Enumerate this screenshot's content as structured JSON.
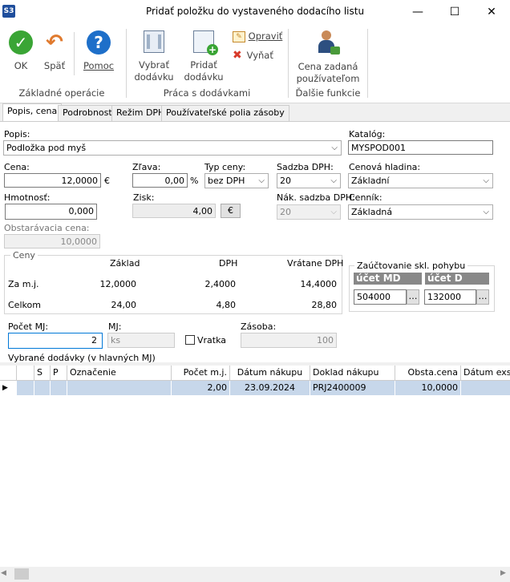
{
  "window": {
    "icon_text": "S3",
    "title": "Pridať položku do vystaveného dodacího listu",
    "minimize": "—",
    "maximize": "☐",
    "close": "✕"
  },
  "ribbon": {
    "ok": "OK",
    "back": "Späť",
    "help": "Pomoc",
    "group_basic": "Základné operácie",
    "select_line1": "Vybrať",
    "select_line2": "dodávku",
    "add_line1": "Pridať",
    "add_line2": "dodávku",
    "edit": "Opraviť",
    "remove": "Vyňať",
    "group_deliveries": "Práca s dodávkami",
    "user_price_line1": "Cena zadaná",
    "user_price_line2": "používateľom",
    "group_other": "Ďalšie funkcie"
  },
  "tabs": [
    "Popis, cena",
    "Podrobnosti",
    "Režim DPH",
    "Používateľské polia zásoby"
  ],
  "form": {
    "popis_label": "Popis:",
    "popis_value": "Podložka pod myš",
    "katalog_label": "Katalóg:",
    "katalog_value": "MYSPOD001",
    "cena_label": "Cena:",
    "cena_value": "12,0000",
    "currency": "€",
    "zlava_label": "Zľava:",
    "zlava_value": "0,00",
    "percent": "%",
    "typ_ceny_label": "Typ ceny:",
    "typ_ceny_value": "bez DPH",
    "sadzba_label": "Sadzba DPH:",
    "sadzba_value": "20",
    "cenova_label": "Cenová hladina:",
    "cenova_value": "Základní",
    "hmotnost_label": "Hmotnosť:",
    "hmotnost_value": "0,000",
    "zisk_label": "Zisk:",
    "zisk_value": "4,00",
    "zisk_btn": "€",
    "nak_sadzba_label": "Nák. sadzba DPH:",
    "nak_sadzba_value": "20",
    "cennik_label": "Cenník:",
    "cennik_value": "Základná",
    "obstaravacia_label": "Obstarávacia cena:",
    "obstaravacia_value": "10,0000"
  },
  "ceny": {
    "title": "Ceny",
    "col_zaklad": "Základ",
    "col_dph": "DPH",
    "col_vratane": "Vrátane DPH",
    "row1_label": "Za m.j.",
    "row1": [
      "12,0000",
      "2,4000",
      "14,4000"
    ],
    "row2_label": "Celkom",
    "row2": [
      "24,00",
      "4,80",
      "28,80"
    ]
  },
  "zauctovanie": {
    "title": "Zaúčtovanie skl. pohybu",
    "md_header": "účet MD",
    "md_value": "504000",
    "d_header": "účet D",
    "d_value": "132000",
    "dots": "…"
  },
  "bottom": {
    "pocet_label": "Počet MJ:",
    "pocet_value": "2",
    "mj_label": "MJ:",
    "mj_value": "ks",
    "vratka_label": "Vratka",
    "zasoba_label": "Zásoba:",
    "zasoba_value": "100",
    "grid_title": "Vybrané dodávky (v hlavných MJ)"
  },
  "grid": {
    "headers": [
      "S",
      "P",
      "Označenie",
      "Počet m.j.",
      "Dátum nákupu",
      "Doklad nákupu",
      "Obsta.cena",
      "Dátum exspi"
    ],
    "row": {
      "pointer": "▶",
      "s": "",
      "p": "",
      "oznacenie": "",
      "pocet": "2,00",
      "datum": "23.09.2024",
      "doklad": "PRJ2400009",
      "cena": "10,0000",
      "exspi": ""
    }
  },
  "colors": {
    "ok_green": "#3aa535",
    "help_blue": "#1e6fc9",
    "back_orange": "#e07a2e",
    "row_selected": "#c7d7ea",
    "account_header": "#888888"
  }
}
